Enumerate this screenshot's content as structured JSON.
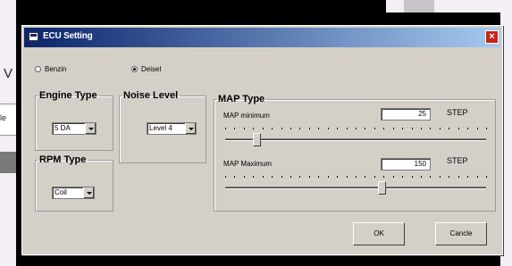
{
  "window": {
    "title": "ECU Setting",
    "close_glyph": "×"
  },
  "background": {
    "left_char": "V",
    "left_text": "le"
  },
  "fuel": {
    "options": [
      {
        "label": "Benzin",
        "checked": false
      },
      {
        "label": "Deisel",
        "checked": true
      }
    ]
  },
  "engine_type": {
    "legend": "Engine Type",
    "value": "5 DA"
  },
  "noise_level": {
    "legend": "Noise Level",
    "value": "Level 4"
  },
  "rpm_type": {
    "legend": "RPM Type",
    "value": "Coil"
  },
  "map_type": {
    "legend": "MAP Type",
    "minimum": {
      "label": "MAP minimum",
      "value": "25",
      "unit": "STEP",
      "slider_fraction": 0.12
    },
    "maximum": {
      "label": "MAP Maximum",
      "value": "150",
      "unit": "STEP",
      "slider_fraction": 0.6
    }
  },
  "buttons": {
    "ok": "OK",
    "cancel": "Cancle"
  },
  "colors": {
    "titlebar_start": "#0a246a",
    "titlebar_end": "#a6caf0",
    "close": "#c8241b",
    "face": "#d4d0c8"
  }
}
